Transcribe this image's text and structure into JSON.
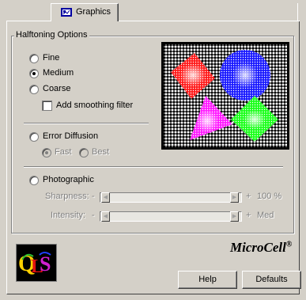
{
  "tab": {
    "label": "Graphics"
  },
  "halftoning": {
    "title": "Halftoning Options",
    "fine": "Fine",
    "medium": "Medium",
    "coarse": "Coarse",
    "selected": "medium",
    "smoothing": "Add smoothing filter",
    "smoothing_checked": false
  },
  "error_diffusion": {
    "label": "Error Diffusion",
    "fast": "Fast",
    "best": "Best",
    "selected_sub": "fast"
  },
  "photographic": {
    "label": "Photographic",
    "sharpness": {
      "label": "Sharpness:",
      "minus": "-",
      "plus": "+",
      "value": "100 %"
    },
    "intensity": {
      "label": "Intensity:",
      "minus": "-",
      "plus": "+",
      "value": "Med"
    }
  },
  "brand": {
    "name": "MicroCell",
    "mark": "®",
    "logo_text": "QLS"
  },
  "buttons": {
    "help": "Help",
    "defaults": "Defaults"
  },
  "preview": {
    "shapes": [
      {
        "name": "red-square",
        "color": "#ff2020"
      },
      {
        "name": "blue-circle",
        "color": "#2020ff"
      },
      {
        "name": "magenta-triangle",
        "color": "#ff20ff"
      },
      {
        "name": "green-diamond",
        "color": "#20ff20"
      }
    ]
  }
}
